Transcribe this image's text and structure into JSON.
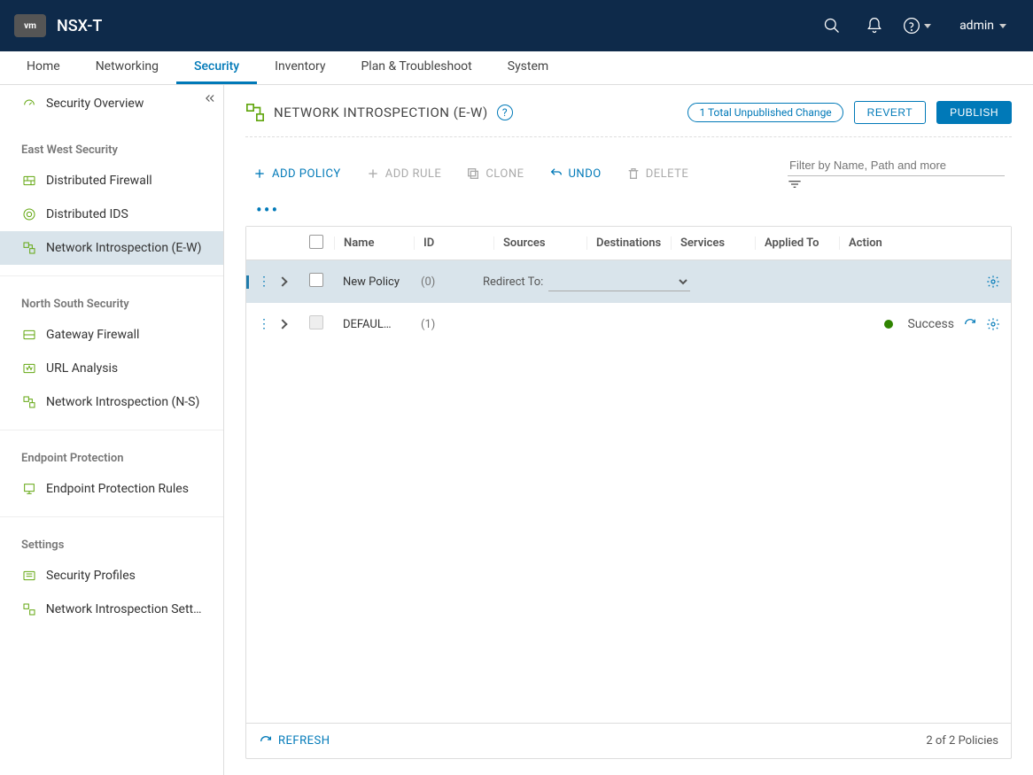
{
  "header": {
    "logo": "vm",
    "product": "NSX-T",
    "user": "admin"
  },
  "tabs": [
    "Home",
    "Networking",
    "Security",
    "Inventory",
    "Plan & Troubleshoot",
    "System"
  ],
  "activeTab": 2,
  "sidebar": {
    "overview": "Security Overview",
    "sections": [
      {
        "title": "East West Security",
        "items": [
          "Distributed Firewall",
          "Distributed IDS",
          "Network Introspection (E-W)"
        ],
        "activeIndex": 2
      },
      {
        "title": "North South Security",
        "items": [
          "Gateway Firewall",
          "URL Analysis",
          "Network Introspection (N-S)"
        ]
      },
      {
        "title": "Endpoint Protection",
        "items": [
          "Endpoint Protection Rules"
        ]
      },
      {
        "title": "Settings",
        "items": [
          "Security Profiles",
          "Network Introspection Setti…"
        ]
      }
    ]
  },
  "page": {
    "title": "NETWORK INTROSPECTION (E-W)",
    "changes_badge": "1 Total Unpublished Change",
    "revert": "REVERT",
    "publish": "PUBLISH"
  },
  "toolbar": {
    "add_policy": "ADD POLICY",
    "add_rule": "ADD RULE",
    "clone": "CLONE",
    "undo": "UNDO",
    "delete": "DELETE",
    "filter_placeholder": "Filter by Name, Path and more"
  },
  "table": {
    "headers": {
      "name": "Name",
      "id": "ID",
      "sources": "Sources",
      "destinations": "Destinations",
      "services": "Services",
      "applied_to": "Applied To",
      "action": "Action"
    },
    "rows": [
      {
        "name": "New Policy",
        "count": "(0)",
        "redirect_label": "Redirect To:",
        "selected": true
      },
      {
        "name": "DEFAUL…",
        "count": "(1)",
        "status": "Success",
        "selected": false
      }
    ],
    "footer": {
      "refresh": "REFRESH",
      "count": "2 of 2 Policies"
    }
  }
}
